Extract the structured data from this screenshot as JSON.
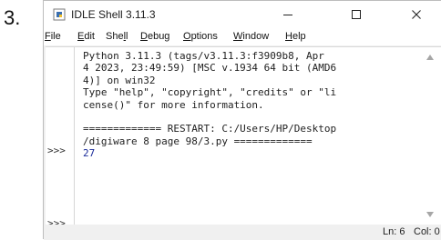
{
  "step_number": "3.",
  "window": {
    "title": "IDLE Shell 3.11.3",
    "controls": {
      "minimize": "minimize-icon",
      "maximize": "maximize-icon",
      "close": "close-icon"
    }
  },
  "menu": [
    {
      "first": "F",
      "rest": "ile",
      "underline_index": 0
    },
    {
      "first": "E",
      "rest": "dit",
      "underline_index": 0
    },
    {
      "label": "Shell"
    },
    {
      "first": "D",
      "rest": "ebug",
      "underline_index": 0
    },
    {
      "first": "O",
      "rest": "ptions",
      "underline_index": 0
    },
    {
      "first": "W",
      "rest": "indow",
      "underline_index": 0
    },
    {
      "first": "H",
      "rest": "elp",
      "underline_index": 0
    }
  ],
  "shell": {
    "prompts": [
      ">>>",
      ">>>"
    ],
    "lines": [
      {
        "text": "Python 3.11.3 (tags/v3.11.3:f3909b8, Apr",
        "color": "normal"
      },
      {
        "text": "4 2023, 23:49:59) [MSC v.1934 64 bit (AMD6",
        "color": "normal"
      },
      {
        "text": "4)] on win32",
        "color": "normal"
      },
      {
        "text": "Type \"help\", \"copyright\", \"credits\" or \"li",
        "color": "normal"
      },
      {
        "text": "cense()\" for more information.",
        "color": "normal"
      },
      {
        "text": "",
        "color": "normal"
      },
      {
        "text": "============= RESTART: C:/Users/HP/Desktop",
        "color": "normal"
      },
      {
        "text": "/digiware 8 page 98/3.py =============",
        "color": "normal"
      },
      {
        "text": "27",
        "color": "blue"
      }
    ]
  },
  "status": {
    "ln": "Ln: 6",
    "col": "Col: 0"
  }
}
